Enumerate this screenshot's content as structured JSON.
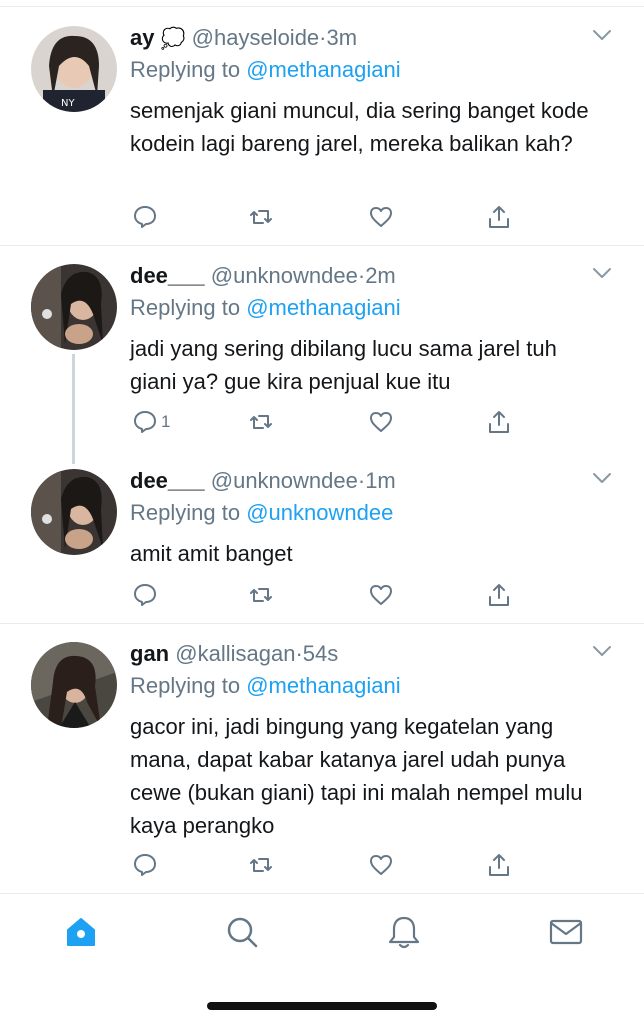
{
  "tweets": [
    {
      "name": "ay",
      "name_emoji": "💭",
      "handle": "@hayseloide",
      "separator": "·",
      "time": "3m",
      "replying_prefix": "Replying to",
      "replying_to": "@methanagiani",
      "text": "semenjak giani muncul, dia sering banget kode kodein lagi bareng jarel, mereka balikan kah?",
      "reply_count": "",
      "icons": [
        "reply-icon",
        "retweet-icon",
        "like-icon",
        "share-icon"
      ]
    },
    {
      "name": "dee___",
      "handle": "@unknowndee",
      "separator": "·",
      "time": "2m",
      "replying_prefix": "Replying to",
      "replying_to": "@methanagiani",
      "text": "jadi yang sering dibilang lucu sama jarel tuh giani ya? gue kira penjual kue itu",
      "reply_count": "1"
    },
    {
      "name": "dee___",
      "handle": "@unknowndee",
      "separator": "·",
      "time": "1m",
      "replying_prefix": "Replying to",
      "replying_to": "@unknowndee",
      "text": "amit amit banget",
      "reply_count": ""
    },
    {
      "name": "gan",
      "handle": "@kallisagan",
      "separator": "·",
      "time": "54s",
      "replying_prefix": "Replying to",
      "replying_to": "@methanagiani",
      "text": "gacor ini, jadi bingung yang kegatelan yang mana, dapat kabar katanya jarel udah punya cewe (bukan giani) tapi ini malah nempel mulu kaya perangko",
      "reply_count": ""
    }
  ],
  "tabbar": {
    "tabs": [
      "home-icon",
      "search-icon",
      "notifications-icon",
      "messages-icon"
    ],
    "active": "home-icon"
  },
  "colors": {
    "accent": "#1da1f2",
    "secondary_text": "#657786",
    "icon_gray": "#657786",
    "divider": "#e6ecf0"
  }
}
